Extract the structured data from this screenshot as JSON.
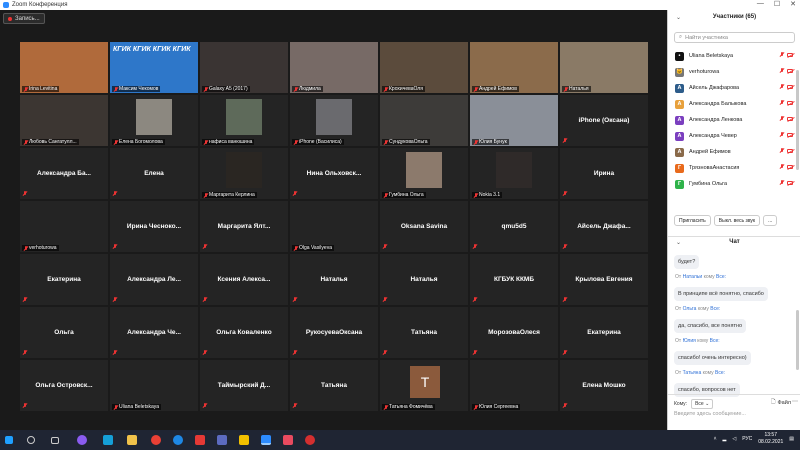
{
  "window": {
    "title": "Zoom Конференция",
    "controls": [
      "—",
      "☐",
      "✕"
    ]
  },
  "recording": {
    "label": "Запись..."
  },
  "grid": [
    {
      "name": "Irina Levitina",
      "kind": "video",
      "active": true,
      "bg": "#b06a3b"
    },
    {
      "name": "Максим Чекомов",
      "kind": "video",
      "bg": "#2e77c9",
      "banner": "КГИК КГИК КГИК КГИК"
    },
    {
      "name": "Galaxy A5 (2017)",
      "kind": "video",
      "bg": "#3a3433"
    },
    {
      "name": "Людмила",
      "kind": "video",
      "bg": "#776a66"
    },
    {
      "name": "КрохичеваОля",
      "kind": "video",
      "bg": "#5b4b3c"
    },
    {
      "name": "Андрей Ефимов",
      "kind": "video",
      "bg": "#8b6b4b"
    },
    {
      "name": "Наталья",
      "kind": "video",
      "bg": "#8a7a66"
    },
    {
      "name": "Любовь Сангатулл...",
      "kind": "video",
      "bg": "#3c3632"
    },
    {
      "name": "Елена Богомолова",
      "kind": "video",
      "bg": "#8c8880"
    },
    {
      "name": "нафиса ванюшина",
      "kind": "video",
      "bg": "#5e6a5a"
    },
    {
      "name": "iPhone (Василиса)",
      "kind": "video",
      "bg": "#6a6a6e"
    },
    {
      "name": "СундуковаОльга",
      "kind": "video",
      "bg": "#3d3b39"
    },
    {
      "name": "Юлия Бунук",
      "kind": "video",
      "bg": "#8a8f98"
    },
    {
      "name": "iPhone (Оксана)",
      "kind": "name"
    },
    {
      "name": "Александра Ба...",
      "kind": "name"
    },
    {
      "name": "Елена",
      "kind": "name"
    },
    {
      "name": "Маргарита Керлина",
      "kind": "video",
      "bg": "#2a2622"
    },
    {
      "name": "Нина Ольховск...",
      "kind": "name"
    },
    {
      "name": "Гумбина Ольга",
      "kind": "video",
      "bg": "#8c7a6c"
    },
    {
      "name": "Nokia 3.1",
      "kind": "video",
      "bg": "#2f2a29"
    },
    {
      "name": "Ирина",
      "kind": "name"
    },
    {
      "name": "verhoturowa",
      "kind": "video",
      "bg": "#242424"
    },
    {
      "name": "Ирина Чесноко...",
      "kind": "name"
    },
    {
      "name": "Маргарита Ялт...",
      "kind": "name"
    },
    {
      "name": "Olga Vasilyeva",
      "kind": "video",
      "bg": "#242424"
    },
    {
      "name": "Oksana Savina",
      "kind": "name"
    },
    {
      "name": "qmu5d5",
      "kind": "name"
    },
    {
      "name": "Айсель Джафа...",
      "kind": "name"
    },
    {
      "name": "Екатерина",
      "kind": "name"
    },
    {
      "name": "Александра Ле...",
      "kind": "name"
    },
    {
      "name": "Ксения Алекса...",
      "kind": "name"
    },
    {
      "name": "Наталья",
      "kind": "name"
    },
    {
      "name": "Наталья",
      "kind": "name"
    },
    {
      "name": "КГБУК ККМБ",
      "kind": "name"
    },
    {
      "name": "Крылова Евгения",
      "kind": "name"
    },
    {
      "name": "Ольга",
      "kind": "name"
    },
    {
      "name": "Александра Че...",
      "kind": "name"
    },
    {
      "name": "Ольга Коваленко",
      "kind": "name"
    },
    {
      "name": "РукосуеваОксана",
      "kind": "name"
    },
    {
      "name": "Татьяна",
      "kind": "name"
    },
    {
      "name": "МорозоваОлеся",
      "kind": "name"
    },
    {
      "name": "Екатерина",
      "kind": "name"
    },
    {
      "name": "Ольга Островск...",
      "kind": "name"
    },
    {
      "name": "Uliana Beletskaya",
      "kind": "video",
      "bg": "#242424"
    },
    {
      "name": "Таймырский Д...",
      "kind": "name"
    },
    {
      "name": "Татьяна",
      "kind": "name"
    },
    {
      "name": "Татьяна Фомичёва",
      "kind": "avatar",
      "letter": "Т"
    },
    {
      "name": "Юлия Сергеевна",
      "kind": "video",
      "bg": "#242424"
    },
    {
      "name": "Елена Мошко",
      "kind": "name"
    }
  ],
  "participants": {
    "title": "Участники (65)",
    "search_placeholder": "Найти участника",
    "list": [
      {
        "name": "Uliana Beletskaya",
        "av": "•",
        "color": "#111111"
      },
      {
        "name": "verhoturowa",
        "av": "🐱",
        "color": "#777777"
      },
      {
        "name": "Айсель Джафарова",
        "av": "А",
        "color": "#2d5c8a"
      },
      {
        "name": "Александра Балыкова",
        "av": "А",
        "color": "#e8a13c"
      },
      {
        "name": "Александра Ленкова",
        "av": "А",
        "color": "#7b3fbf"
      },
      {
        "name": "Александра Чевер",
        "av": "А",
        "color": "#7b3fbf"
      },
      {
        "name": "Андрей Ефимов",
        "av": "А",
        "color": "#8a6a4a"
      },
      {
        "name": "ТрязноваАнастасия",
        "av": "Г",
        "color": "#e86a1c"
      },
      {
        "name": "Гумбина Ольга",
        "av": "Г",
        "color": "#2fb34a"
      }
    ],
    "buttons": [
      "Пригласить",
      "Выкл. весь звук",
      "..."
    ]
  },
  "chat": {
    "title": "Чат",
    "first_line": "будет?",
    "messages": [
      {
        "from": "Натальи",
        "to": "Все",
        "text": "В принципе всё понятно, спасибо"
      },
      {
        "from": "Ольга",
        "to": "Все",
        "text": "да, спасибо, все понятно"
      },
      {
        "from": "Юлия",
        "to": "Все",
        "text": "спасибо! очень интересно)"
      },
      {
        "from": "Татьяна",
        "to": "Все",
        "text": "спасибо, вопросов нет"
      }
    ],
    "from_prefix": "От",
    "to_word": "кому",
    "to_label": "Кому:",
    "to_value": "Все",
    "file_label": "Файл",
    "input_placeholder": "Введите здесь сообщение..."
  },
  "taskbar": {
    "lang": "РУС",
    "time": "13:57",
    "date": "08.02.2021"
  }
}
